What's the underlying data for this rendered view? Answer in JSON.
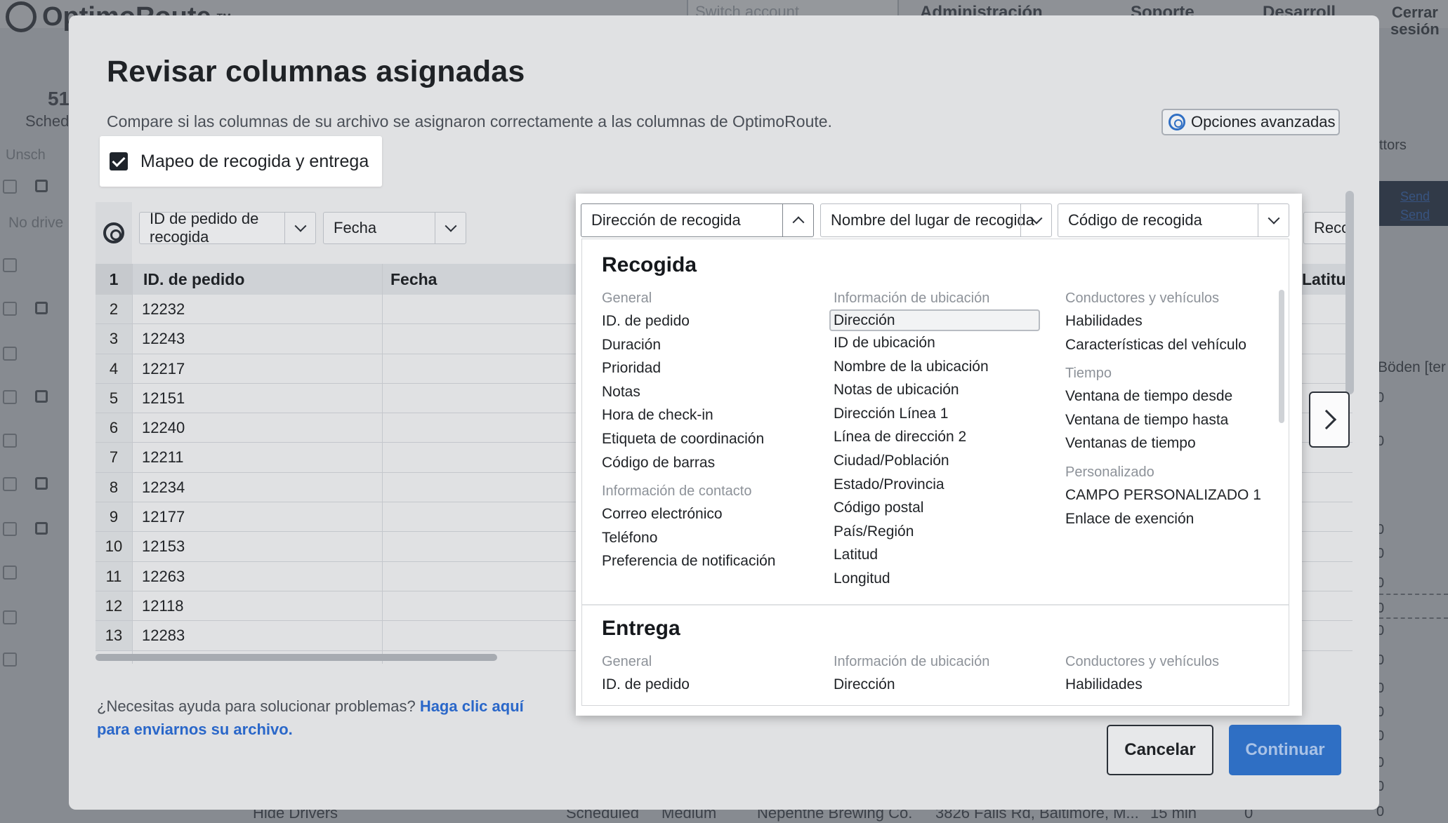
{
  "background": {
    "brand": "OptimoRoute",
    "trademark": "TM",
    "switch_account": "Switch account",
    "menu": [
      "Administración",
      "Soporte",
      "Desarroll"
    ],
    "logout": [
      "Cerrar",
      "sesión"
    ],
    "stat_num": "51",
    "stat_label": "Sched",
    "unscheduled": "Unsch",
    "no_drivers": "No drive",
    "right_text": "ttors",
    "send": "Send",
    "boden": "Böden [ter",
    "hide_drivers": "Hide Drivers",
    "bottom_row": [
      "Scheduled",
      "Medium",
      "Nepenthe Brewing Co.",
      "3826 Falls Rd, Baltimore, M...",
      "15 min",
      "0"
    ],
    "right_nums": [
      "0",
      "0",
      "0",
      "0",
      "0",
      "0",
      "0",
      "0",
      "0",
      "0",
      "0",
      "0",
      "0",
      "0"
    ]
  },
  "modal": {
    "title": "Revisar columnas asignadas",
    "subtitle": "Compare si las columnas de su archivo se asignaron correctamente a las columnas de OptimoRoute.",
    "advanced_options": "Opciones avanzadas",
    "pickup_delivery_mapping": "Mapeo de recogida y entrega",
    "columns": [
      {
        "selected": "ID de pedido de recogida",
        "header": "ID. de pedido"
      },
      {
        "selected": "Fecha",
        "header": "Fecha"
      },
      {
        "selected": "Dirección de recogida",
        "header": ""
      },
      {
        "selected": "Nombre del lugar de recogida",
        "header": ""
      },
      {
        "selected": "Código de recogida",
        "header": ""
      },
      {
        "selected": "Recog",
        "header": "Latitu"
      }
    ],
    "rows": [
      {
        "n": "1",
        "v": "ID. de pedido"
      },
      {
        "n": "2",
        "v": "12232"
      },
      {
        "n": "3",
        "v": "12243"
      },
      {
        "n": "4",
        "v": "12217"
      },
      {
        "n": "5",
        "v": "12151"
      },
      {
        "n": "6",
        "v": "12240"
      },
      {
        "n": "7",
        "v": "12211"
      },
      {
        "n": "8",
        "v": "12234"
      },
      {
        "n": "9",
        "v": "12177"
      },
      {
        "n": "10",
        "v": "12153"
      },
      {
        "n": "11",
        "v": "12263"
      },
      {
        "n": "12",
        "v": "12118"
      },
      {
        "n": "13",
        "v": "12283"
      }
    ],
    "help_text": "¿Necesitas ayuda para solucionar problemas?",
    "help_link": "Haga clic aquí para enviarnos su archivo.",
    "cancel": "Cancelar",
    "continue": "Continuar"
  },
  "dropdown": {
    "recogida": {
      "title": "Recogida",
      "general_title": "General",
      "general": [
        "ID. de pedido",
        "Duración",
        "Prioridad",
        "Notas",
        "Hora de check-in",
        "Etiqueta de coordinación",
        "Código de barras"
      ],
      "contact_title": "Información de contacto",
      "contact": [
        "Correo electrónico",
        "Teléfono",
        "Preferencia de notificación"
      ],
      "location_title": "Información de ubicación",
      "location": [
        "Dirección",
        "ID de ubicación",
        "Nombre de la ubicación",
        "Notas de ubicación",
        "Dirección Línea 1",
        "Línea de dirección 2",
        "Ciudad/Población",
        "Estado/Provincia",
        "Código postal",
        "País/Región",
        "Latitud",
        "Longitud"
      ],
      "drivers_title": "Conductores y vehículos",
      "drivers": [
        "Habilidades",
        "Características del vehículo"
      ],
      "time_title": "Tiempo",
      "time": [
        "Ventana de tiempo desde",
        "Ventana de tiempo hasta",
        "Ventanas de tiempo"
      ],
      "custom_title": "Personalizado",
      "custom": [
        "CAMPO PERSONALIZADO 1",
        "Enlace de exención"
      ]
    },
    "entrega": {
      "title": "Entrega",
      "general_title": "General",
      "general_first": "ID. de pedido",
      "location_title": "Información de ubicación",
      "location_first": "Dirección",
      "drivers_title": "Conductores y vehículos",
      "drivers_first": "Habilidades"
    }
  },
  "colors": {
    "accent": "#2f6fc4",
    "link": "#2a67c9",
    "text": "#1f2226",
    "muted": "#8d9299"
  }
}
